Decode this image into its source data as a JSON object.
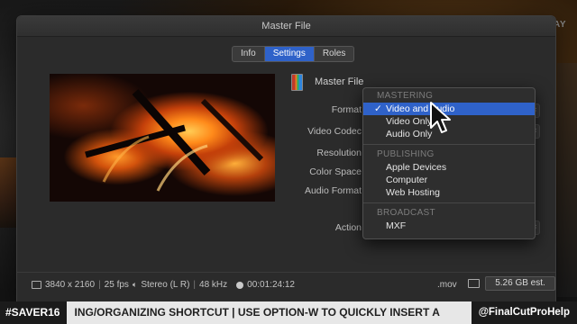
{
  "overlay": {
    "replay": "REPLAY"
  },
  "dialog": {
    "title": "Master File",
    "tabs": [
      {
        "label": "Info",
        "active": false
      },
      {
        "label": "Settings",
        "active": true
      },
      {
        "label": "Roles",
        "active": false
      }
    ],
    "header": {
      "label": "Master File"
    },
    "fields": {
      "format": "Format",
      "video_codec": "Video Codec",
      "resolution": "Resolution",
      "color_space": "Color Space",
      "audio_format": "Audio Format",
      "action": "Action"
    },
    "menu": {
      "sections": [
        {
          "title": "MASTERING",
          "items": [
            "Video and Audio",
            "Video Only",
            "Audio Only"
          ],
          "selected": "Video and Audio"
        },
        {
          "title": "PUBLISHING",
          "items": [
            "Apple Devices",
            "Computer",
            "Web Hosting"
          ]
        },
        {
          "title": "BROADCAST",
          "items": [
            "MXF"
          ]
        }
      ]
    },
    "footer": {
      "resolution": "3840 x 2160",
      "fps": "25 fps",
      "audio": "Stereo (L R)",
      "sample_rate": "48 kHz",
      "duration": "00:01:24:12",
      "extension": ".mov",
      "size_estimate": "5.26 GB est."
    }
  },
  "ticker": {
    "tag": "#SAVER16",
    "text": "ING/ORGANIZING SHORTCUT | USE OPTION-W TO QUICKLY INSERT A",
    "handle": "@FinalCutProHelp"
  },
  "colors": {
    "accent": "#2f62c9",
    "dialog_bg": "#2b2b2b",
    "ticker_bg": "#e7e7e7"
  }
}
